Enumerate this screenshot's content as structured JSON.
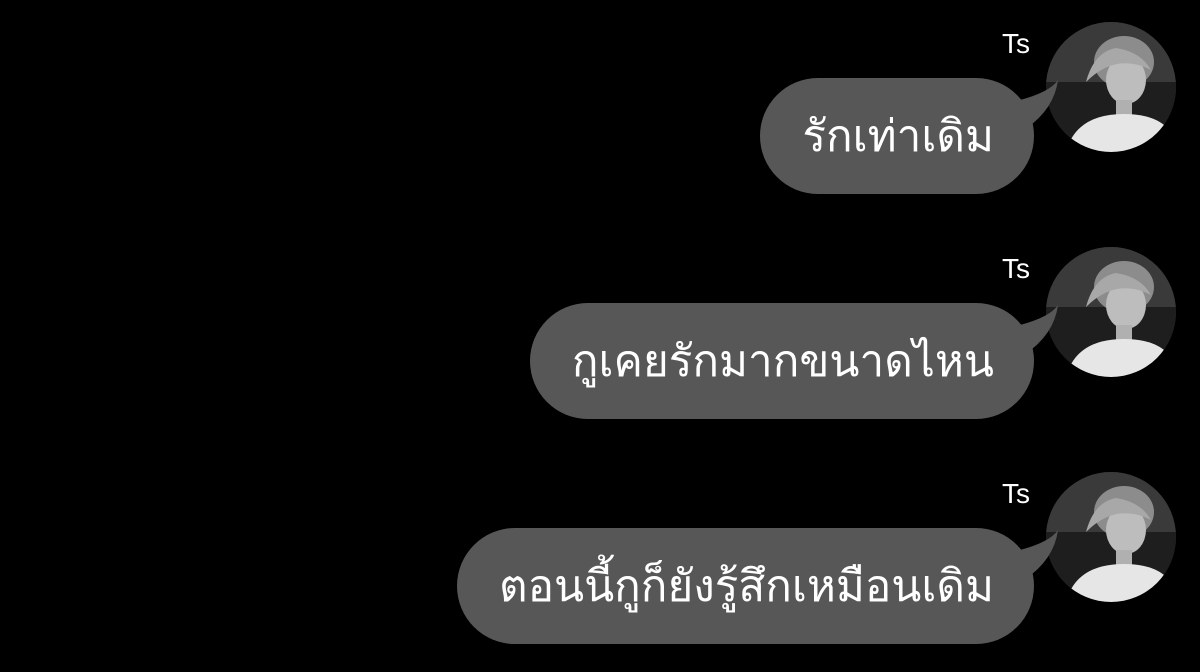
{
  "messages": [
    {
      "sender": "Ts",
      "text": "รักเท่าเดิม",
      "avatar": "avatar-photo"
    },
    {
      "sender": "Ts",
      "text": "กูเคยรักมากขนาดไหน",
      "avatar": "avatar-photo"
    },
    {
      "sender": "Ts",
      "text": "ตอนนี้กูก็ยังรู้สึกเหมือนเดิม",
      "avatar": "avatar-photo"
    }
  ],
  "colors": {
    "background": "#000000",
    "bubble": "#575757",
    "text": "#ffffff"
  }
}
